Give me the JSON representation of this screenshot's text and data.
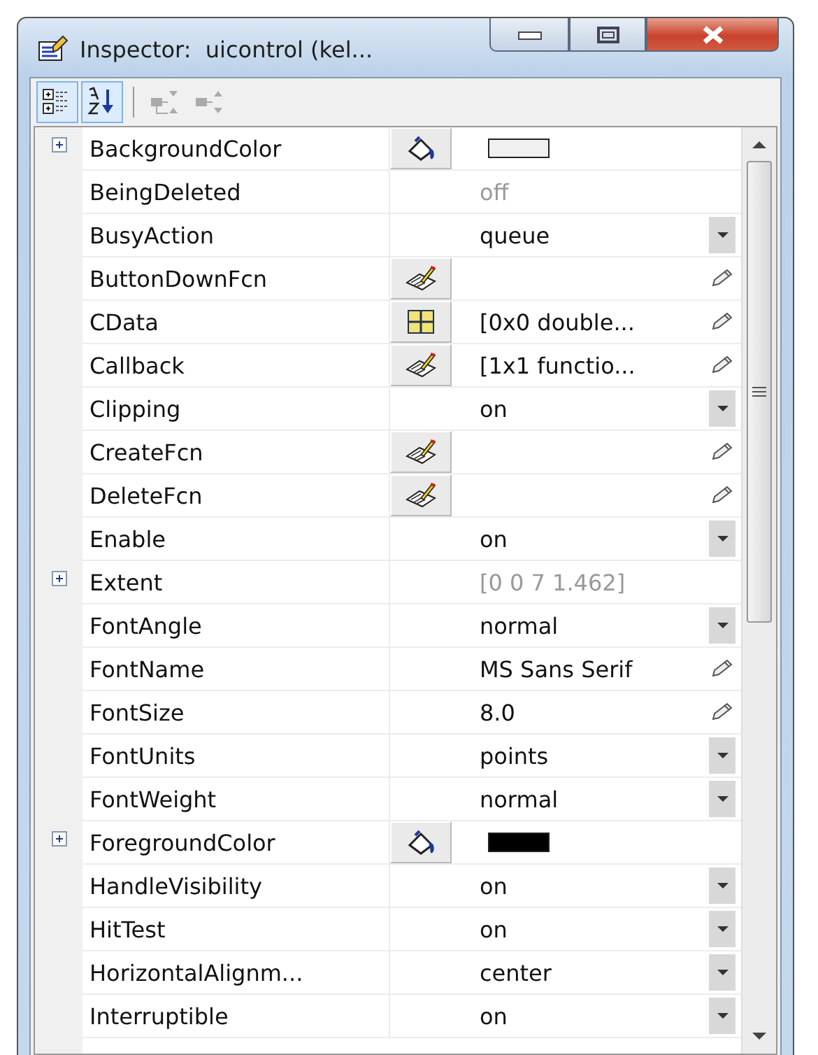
{
  "window": {
    "title": "Inspector:  uicontrol (kel..."
  },
  "toolbar": [
    {
      "kind": "categorized",
      "selected": true,
      "disabled": false
    },
    {
      "kind": "alphabetical",
      "selected": true,
      "disabled": false
    },
    {
      "kind": "collapse",
      "selected": false,
      "disabled": true
    },
    {
      "kind": "expand",
      "selected": false,
      "disabled": true
    }
  ],
  "properties": [
    {
      "name": "BackgroundColor",
      "expandable": true,
      "button": {
        "kind": "color"
      },
      "editor": {
        "kind": "swatch"
      },
      "color": "#f0f0f0"
    },
    {
      "name": "BeingDeleted",
      "expandable": false,
      "value": "off",
      "readonly": true
    },
    {
      "name": "BusyAction",
      "expandable": false,
      "value": "queue",
      "editor": {
        "kind": "dropdown"
      }
    },
    {
      "name": "ButtonDownFcn",
      "expandable": false,
      "button": {
        "kind": "callback"
      },
      "editor": {
        "kind": "pencil"
      }
    },
    {
      "name": "CData",
      "expandable": false,
      "button": {
        "kind": "matrix"
      },
      "value": "[0x0  double...",
      "editor": {
        "kind": "pencil"
      }
    },
    {
      "name": "Callback",
      "expandable": false,
      "button": {
        "kind": "callback"
      },
      "value": "[1x1  functio...",
      "editor": {
        "kind": "pencil"
      }
    },
    {
      "name": "Clipping",
      "expandable": false,
      "value": "on",
      "editor": {
        "kind": "dropdown"
      }
    },
    {
      "name": "CreateFcn",
      "expandable": false,
      "button": {
        "kind": "callback"
      },
      "editor": {
        "kind": "pencil"
      }
    },
    {
      "name": "DeleteFcn",
      "expandable": false,
      "button": {
        "kind": "callback"
      },
      "editor": {
        "kind": "pencil"
      }
    },
    {
      "name": "Enable",
      "expandable": false,
      "value": "on",
      "editor": {
        "kind": "dropdown"
      }
    },
    {
      "name": "Extent",
      "expandable": true,
      "value": "[0 0 7 1.462]",
      "readonly": true
    },
    {
      "name": "FontAngle",
      "expandable": false,
      "value": "normal",
      "editor": {
        "kind": "dropdown"
      }
    },
    {
      "name": "FontName",
      "expandable": false,
      "value": "MS Sans Serif",
      "editor": {
        "kind": "pencil"
      }
    },
    {
      "name": "FontSize",
      "expandable": false,
      "value": "8.0",
      "editor": {
        "kind": "pencil"
      }
    },
    {
      "name": "FontUnits",
      "expandable": false,
      "value": "points",
      "editor": {
        "kind": "dropdown"
      }
    },
    {
      "name": "FontWeight",
      "expandable": false,
      "value": "normal",
      "editor": {
        "kind": "dropdown"
      }
    },
    {
      "name": "ForegroundColor",
      "expandable": true,
      "button": {
        "kind": "color"
      },
      "editor": {
        "kind": "swatch"
      },
      "color": "#000000"
    },
    {
      "name": "HandleVisibility",
      "expandable": false,
      "value": "on",
      "editor": {
        "kind": "dropdown"
      }
    },
    {
      "name": "HitTest",
      "expandable": false,
      "value": "on",
      "editor": {
        "kind": "dropdown"
      }
    },
    {
      "name": "HorizontalAlignm...",
      "expandable": false,
      "value": "center",
      "editor": {
        "kind": "dropdown"
      }
    },
    {
      "name": "Interruptible",
      "expandable": false,
      "value": "on",
      "editor": {
        "kind": "dropdown"
      }
    }
  ]
}
